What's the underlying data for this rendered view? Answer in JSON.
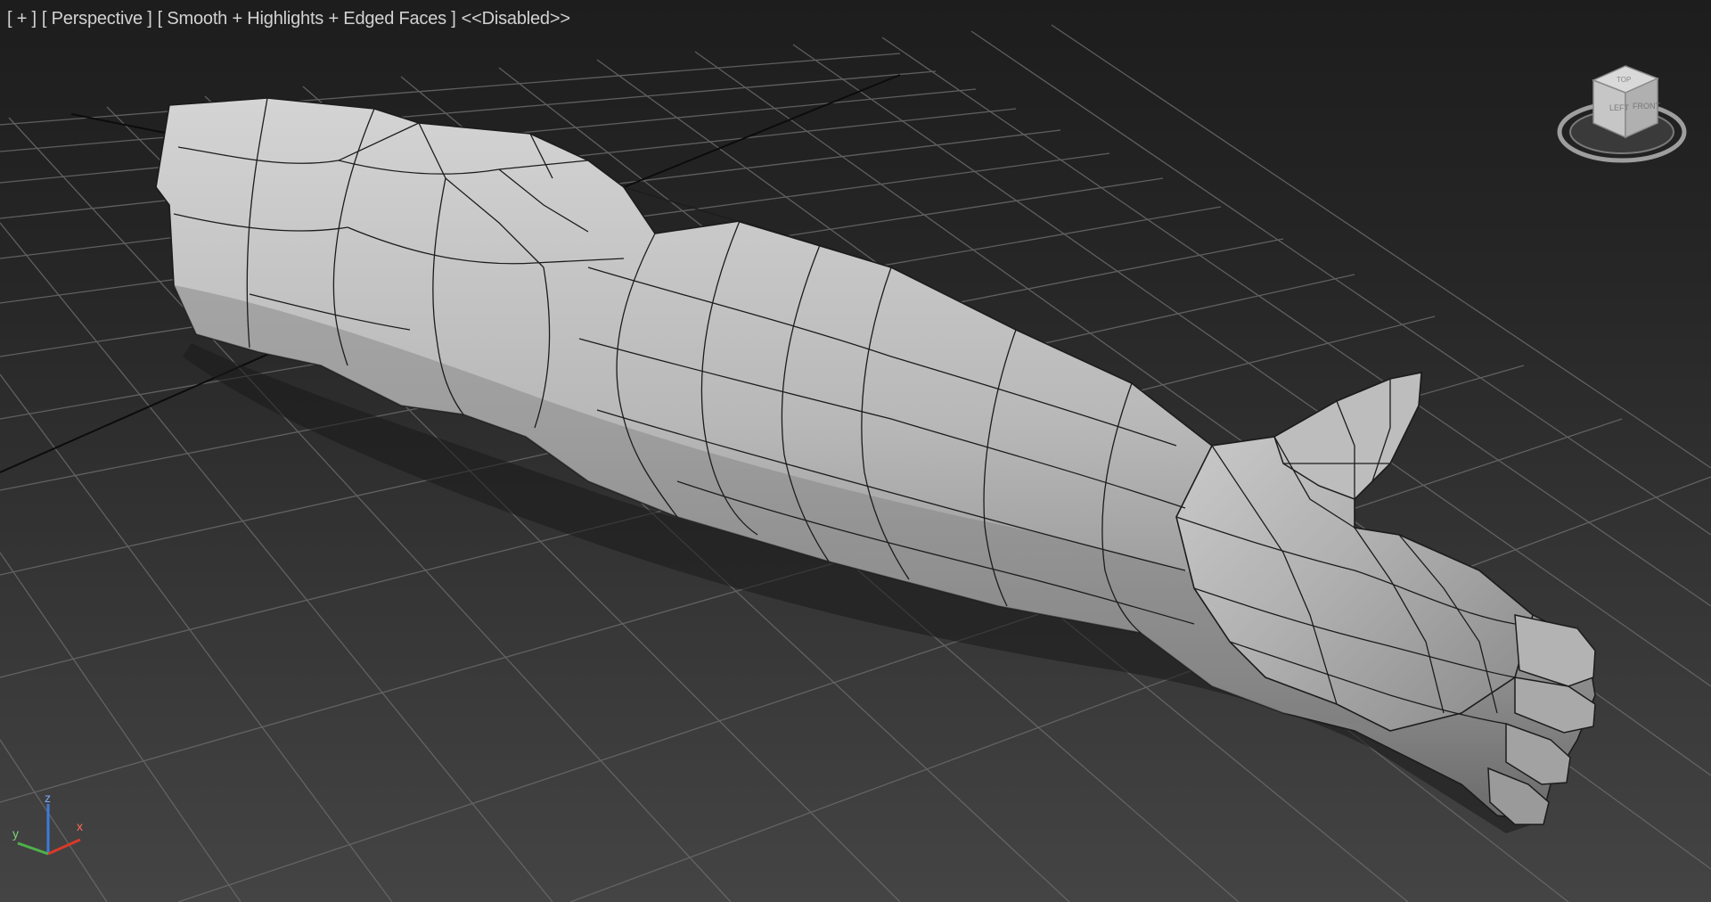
{
  "viewport": {
    "label": {
      "plus": "[ + ]",
      "view": "[ Perspective ]",
      "shading": "[ Smooth + Highlights + Edged Faces ]",
      "status": "<<Disabled>>"
    },
    "viewcube": {
      "face_left": "LEFT",
      "face_front": "FRONT",
      "face_top": "TOP",
      "icon": "viewcube-icon"
    },
    "axis_tripod": {
      "x": "x",
      "y": "y",
      "z": "z",
      "colors": {
        "x": "#d83a2a",
        "y": "#4fb14a",
        "z": "#3e7bd8"
      }
    },
    "colors": {
      "background_top": "#1d1d1d",
      "background_bottom": "#444444",
      "grid": "#6a6a6a",
      "mesh": "#b9b9b9",
      "mesh_edges": "#1c1c1c"
    },
    "object": "arm-mesh"
  }
}
